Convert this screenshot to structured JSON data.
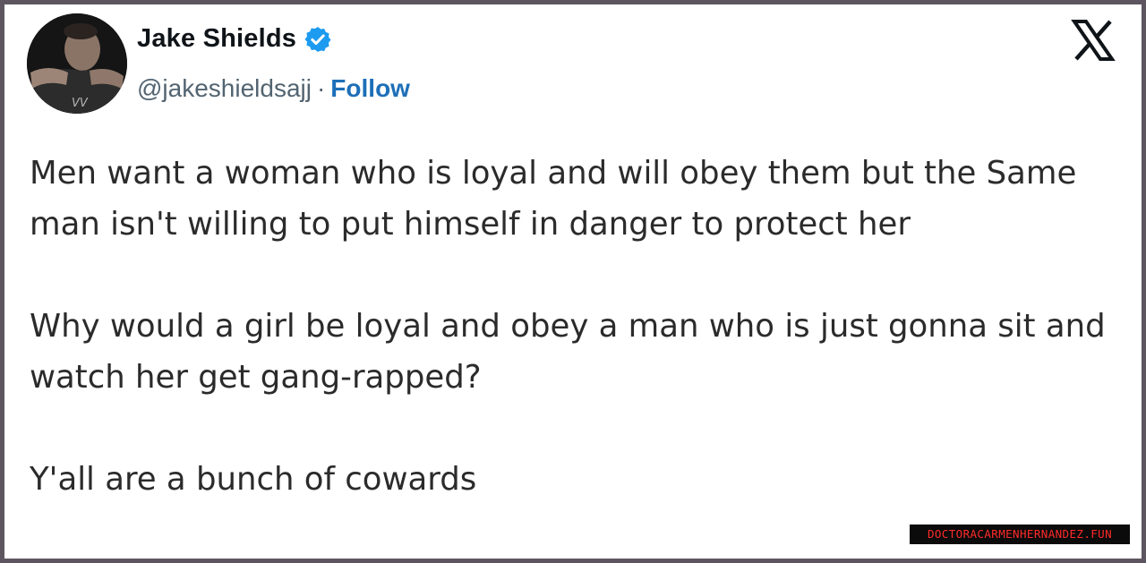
{
  "tweet": {
    "author": {
      "display_name": "Jake Shields",
      "verified": true,
      "verified_badge_color": "#1d9bf0",
      "avatar_icon": "profile-photo",
      "handle": "@jakeshieldsajj",
      "separator": "·",
      "follow_label": "Follow",
      "follow_color": "#1d6fb8"
    },
    "platform_icon": "x-logo-icon",
    "body": {
      "paragraph_1": "Men want a woman who is loyal and will obey them but the Same man isn't willing to put himself in danger to protect her",
      "paragraph_2": "Why would a girl be loyal and obey a man who is just gonna sit and watch her get gang-rapped?",
      "paragraph_3": "Y'all are a bunch of cowards"
    }
  },
  "watermark": {
    "text": "DOCTORACARMENHERNANDEZ.FUN",
    "text_color": "#ff2a2a"
  }
}
